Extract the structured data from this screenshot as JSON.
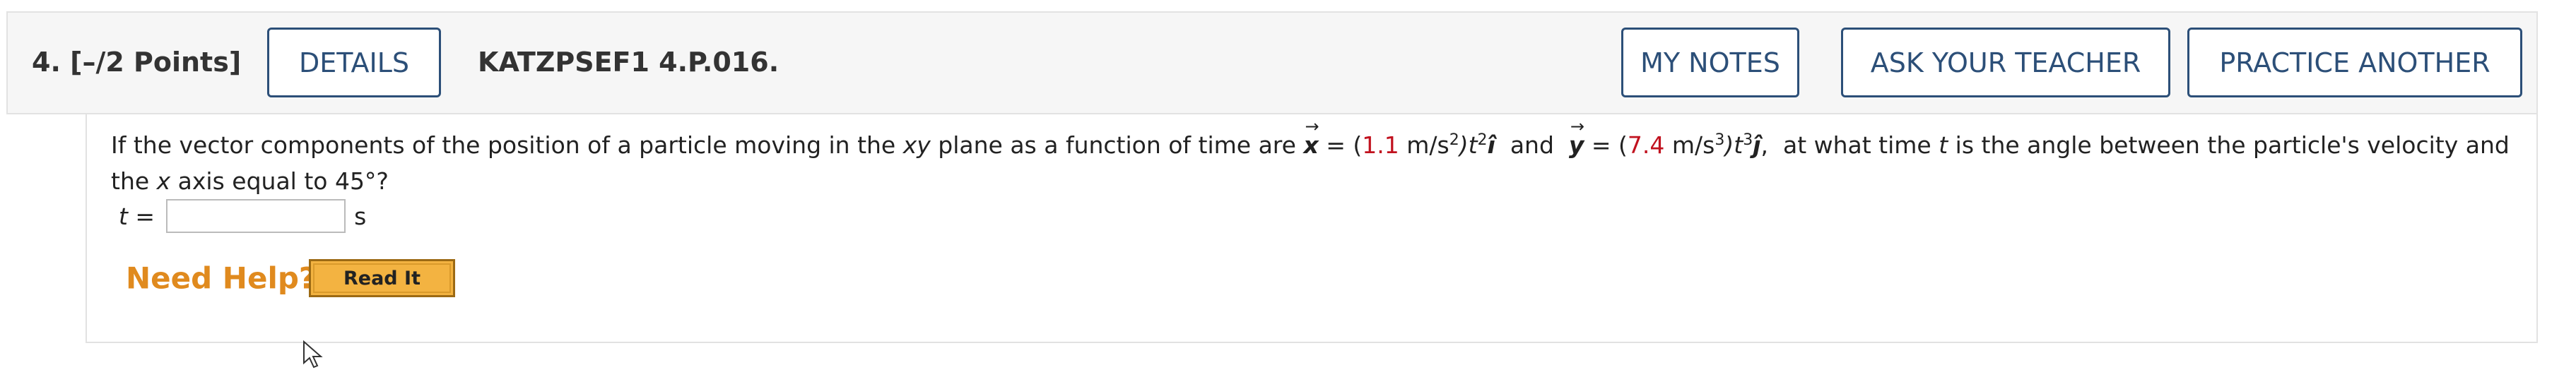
{
  "question": {
    "number_points": "4.  [–/2 Points]",
    "details_label": "DETAILS",
    "code": "KATZPSEF1 4.P.016.",
    "my_notes_label": "MY NOTES",
    "ask_teacher_label": "ASK YOUR TEACHER",
    "practice_label": "PRACTICE ANOTHER"
  },
  "problem": {
    "text_1": "If the vector components of the position of a particle moving in the ",
    "xy": "xy",
    "text_2": " plane as a function of time are ",
    "vec_x": "x",
    "eq": " = (",
    "val_x": "1.1",
    "unit_x": " m/s",
    "unit_x_exp": "2",
    "t_x": ")t",
    "t_x_exp": "2",
    "hat_i": "î",
    "and": "  and  ",
    "vec_y": "y",
    "eq2": " = (",
    "val_y": "7.4",
    "unit_y": " m/s",
    "unit_y_exp": "3",
    "t_y": ")t",
    "t_y_exp": "3",
    "hat_j": "ĵ",
    "text_3": ",  at what time ",
    "t": "t",
    "text_4": " is the angle between the particle's velocity and the ",
    "x_axis": "x",
    "text_5": " axis equal to 45°?",
    "answer_label": "t =",
    "answer_value": "",
    "answer_unit": "s"
  },
  "help": {
    "label": "Need Help?",
    "read_it_label": "Read It"
  },
  "colors": {
    "accent": "#2c4f78",
    "value_red": "#c1121f",
    "help_orange": "#e08a1e",
    "read_it_bg": "#f3b341"
  },
  "icons": [
    "mouse-pointer-icon"
  ]
}
